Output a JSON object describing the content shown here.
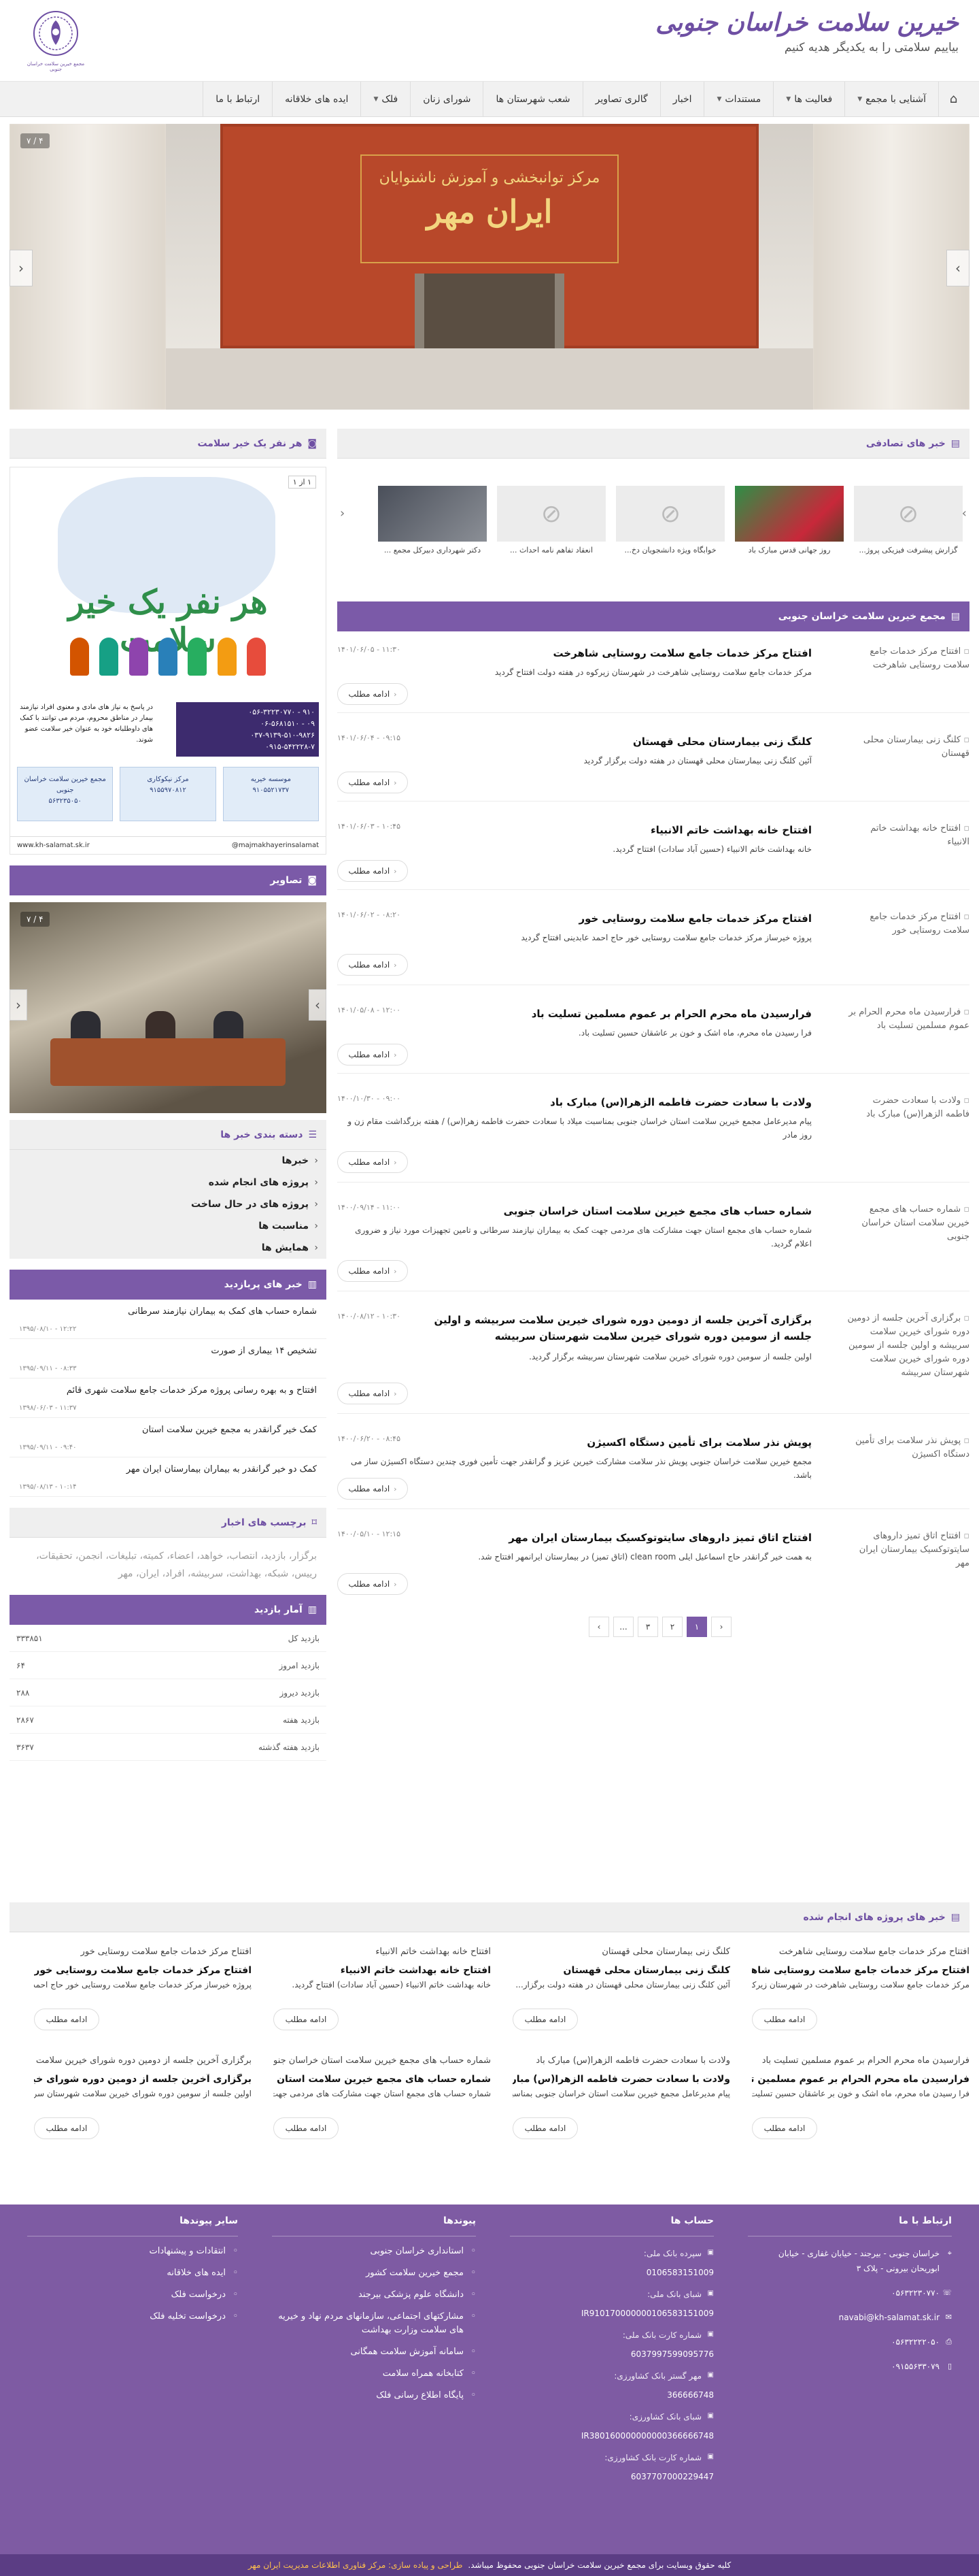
{
  "header": {
    "title": "خیرین سلامت خراسان جنوبی",
    "slogan": "بیاییم سلامتی را به یکدیگر هدیه کنیم",
    "emblem_text": "مجمع خیرین سلامت خراسان جنوبی"
  },
  "nav": {
    "home_icon": "home-icon",
    "items": [
      {
        "label": "آشنایی با مجمع",
        "dropdown": true
      },
      {
        "label": "فعالیت ها",
        "dropdown": true
      },
      {
        "label": "مستندات",
        "dropdown": true
      },
      {
        "label": "اخبار",
        "dropdown": false
      },
      {
        "label": "گالری تصاویر",
        "dropdown": false
      },
      {
        "label": "شعب شهرستان ها",
        "dropdown": false
      },
      {
        "label": "شورای زنان",
        "dropdown": false
      },
      {
        "label": "فلک",
        "dropdown": true
      },
      {
        "label": "ایده های خلاقانه",
        "dropdown": false
      },
      {
        "label": "ارتباط با ما",
        "dropdown": false
      }
    ]
  },
  "slider": {
    "counter": "۴ / ۷",
    "sign_line1": "مرکز توانبخشی و آموزش ناشنوایان",
    "sign_line2": "ایران مهر"
  },
  "random_news": {
    "heading": "خبر های تصادفی",
    "items": [
      {
        "caption": "گزارش پیشرفت فیزیکی پروژ...",
        "img": "placeholder"
      },
      {
        "caption": "روز جهانی قدس مبارک باد",
        "img": "flag"
      },
      {
        "caption": "خوابگاه ویژه دانشجویان دخ...",
        "img": "placeholder"
      },
      {
        "caption": "انعقاد تفاهم نامه احداث ...",
        "img": "placeholder"
      },
      {
        "caption": "دکتر شهرداری دبیرکل مجمع ...",
        "img": "photo"
      }
    ]
  },
  "main_news": {
    "heading": "مجمع خیرین سلامت خراسان جنوبی",
    "more_label": "ادامه مطلب",
    "items": [
      {
        "thumb": "افتتاح مرکز خدمات جامع سلامت روستایی شاهرخت",
        "title": "افتتاح مرکز خدمات جامع سلامت روستایی شاهرخت",
        "body": "مرکز خدمات جامع سلامت روستایی شاهرخت در شهرستان زیرکوه در هفته دولت افتتاح گردید",
        "date": "۱۴۰۱/۰۶/۰۵ - ۱۱:۳۰"
      },
      {
        "thumb": "کلنگ زنی بیمارستان محلی قهستان",
        "title": "کلنگ زنی بیمارستان محلی قهستان",
        "body": "آئین کلنگ زنی بیمارستان محلی قهستان در هفته دولت برگزار گردید",
        "date": "۱۴۰۱/۰۶/۰۴ - ۰۹:۱۵"
      },
      {
        "thumb": "افتتاح خانه بهداشت خاتم الانبیاء",
        "title": "افتتاح خانه بهداشت خاتم الانبیاء",
        "body": "خانه بهداشت خاتم الانبیاء (حسین آباد سادات) افتتاح گردید.",
        "date": "۱۴۰۱/۰۶/۰۳ - ۱۰:۴۵"
      },
      {
        "thumb": "افتتاح مرکز خدمات جامع سلامت روستایی خور",
        "title": "افتتاح مرکز خدمات جامع سلامت روستایی خور",
        "body": "پروژه خیرساز مرکز خدمات جامع سلامت روستایی خور حاج احمد عابدینی افتتاح گردید",
        "date": "۱۴۰۱/۰۶/۰۲ - ۰۸:۲۰"
      },
      {
        "thumb": "فرارسیدن ماه محرم الحرام بر عموم مسلمین تسلیت باد",
        "title": "فرارسیدن ماه محرم الحرام بر عموم مسلمین تسلیت باد",
        "body": "فرا رسیدن ماه محرم، ماه اشک و خون بر عاشقان حسین تسلیت باد.",
        "date": "۱۴۰۱/۰۵/۰۸ - ۱۲:۰۰"
      },
      {
        "thumb": "ولادت با سعادت حضرت فاطمه الزهرا(س) مبارک باد",
        "title": "ولادت با سعادت حضرت فاطمه الزهرا(س) مبارک باد",
        "body": "پیام مدیرعامل مجمع خیرین سلامت استان خراسان جنوبی بمناسبت میلاد با سعادت حضرت فاطمه زهرا(س) / هفته بزرگداشت مقام زن و روز مادر",
        "date": "۱۴۰۰/۱۰/۳۰ - ۰۹:۰۰"
      },
      {
        "thumb": "شماره حساب های مجمع خیرین سلامت استان خراسان جنوبی",
        "title": "شماره حساب های مجمع خیرین سلامت استان خراسان جنوبی",
        "body": "شماره حساب های مجمع استان جهت مشارکت های مردمی جهت کمک به بیماران نیازمند سرطانی و تامین تجهیزات مورد نیاز و ضروری اعلام گردید.",
        "date": "۱۴۰۰/۰۹/۱۴ - ۱۱:۰۰"
      },
      {
        "thumb": "برگزاری آخرین جلسه از دومین دوره شورای خیرین سلامت سربیشه و اولین جلسه از سومین دوره شورای خیرین سلامت شهرستان سربیشه",
        "title": "برگزاری آخرین جلسه از دومین دوره شورای خیرین سلامت سربیشه و اولین جلسه از سومین دوره شورای خیرین سلامت شهرستان سربیشه",
        "body": "اولین جلسه از سومین دوره شورای خیرین سلامت شهرستان سربیشه برگزار گردید.",
        "date": "۱۴۰۰/۰۸/۱۲ - ۱۰:۳۰"
      },
      {
        "thumb": "پویش نذر سلامت برای تأمین دستگاه اکسیژن",
        "title": "پویش نذر سلامت برای تأمین دستگاه اکسیژن",
        "body": "مجمع خیرین سلامت خراسان جنوبی پویش نذر سلامت مشارکت خیرین عزیز و گرانقدر جهت تأمین فوری چندین دستگاه اکسیژن ساز می باشد.",
        "date": "۱۴۰۰/۰۶/۲۰ - ۰۸:۴۵"
      },
      {
        "thumb": "افتتاح اتاق تمیز داروهای سایتوتوکسیک بیمارستان ایران مهر",
        "title": "افتتاح اتاق تمیز داروهای سایتوتوکسیک بیمارستان ایران مهر",
        "body": "به همت خیر گرانقدر حاج اسماعیل ایلی clean room (اتاق تمیز) در بیمارستان ایرانمهر افتتاح شد.",
        "date": "۱۴۰۰/۰۵/۱۰ - ۱۲:۱۵"
      }
    ]
  },
  "pagination": {
    "pages": [
      "۱",
      "۲",
      "۳",
      "...",
      "›"
    ],
    "prev": "‹",
    "active": "۱"
  },
  "sidebar": {
    "poster_heading": "هر نفر یک خیر سلامت",
    "poster": {
      "counter": "۱ از ۱",
      "title": "هر نفر یک خیر سلامت",
      "sub": "در پاسخ به نیاز های مادی و معنوی افراد نیازمند بیمار در مناطق محروم، مردم می توانند با کمک های داوطلبانه خود به عنوان خیر سلامت عضو شوند.",
      "phones": [
        "۰۵۶-۳۲۲۳۰۷۷۰ - ۹۱۰",
        "۰۶-۵۶۸۱۵۱۰ - ۰۹",
        "۰۳۷-۹۱۳۹-۵۱۰-۹۸۲۶",
        "۰۹۱۵-۵۴۲۲۲۸-۷"
      ],
      "card1": "مجمع خیرین سلامت خراسان جنوبی",
      "card2": "مرکز نیکوکاری",
      "card3": "موسسه خیریه",
      "card1_num": "۵۶۳۲۳۵۰۵۰",
      "card2_num": "۹۱۵۵۹۷۰۸۱۲",
      "card3_num": "۹۱۰۵۵۲۱۷۳۷",
      "site": "www.kh-salamat.sk.ir",
      "handle": "@majmakhayerinsalamat"
    },
    "gallery_heading": "تصاویر",
    "gallery_counter": "۴ / ۷",
    "categories_heading": "دسته بندی خبر ها",
    "categories": [
      "خبرها",
      "پروژه های انجام شده",
      "پروژه های در حال ساخت",
      "مناسبت ها",
      "همایش ها"
    ],
    "popular_heading": "خبر های پربازدید",
    "popular": [
      {
        "title": "شماره حساب های کمک به بیماران نیازمند سرطانی",
        "date": "۱۳۹۵/۰۸/۱۰ - ۱۲:۲۲"
      },
      {
        "title": "تشخیص ۱۴ بیماری از صورت",
        "date": "۱۳۹۵/۰۹/۱۱ - ۰۸:۳۳"
      },
      {
        "title": "افتتاح و به بهره رسانی پروژه مرکز خدمات جامع سلامت شهری قائم",
        "date": "۱۳۹۸/۰۶/۰۳ - ۱۱:۳۷"
      },
      {
        "title": "کمک خیر گرانقدر به مجمع خیرین سلامت استان",
        "date": "۱۳۹۵/۰۹/۱۱ - ۰۹:۴۰"
      },
      {
        "title": "کمک دو خیر گرانقدر به بیماران بیمارستان ایران مهر",
        "date": "۱۳۹۵/۰۸/۱۳ - ۱۰:۱۴"
      }
    ],
    "tags_heading": "برچسب های اخبار",
    "tags": "برگزار، بازدید، انتصاب، خواهد، اعضاء، کمیته، تبلیغات، انجمن، تحقیقات، رییس، شبکه، بهداشت، سربیشه، افراد، ایران، مهر",
    "stats_heading": "آمار بازدید",
    "stats": [
      {
        "label": "بازدید کل",
        "value": "۳۳۳۸۵۱"
      },
      {
        "label": "بازدید امروز",
        "value": "۶۴"
      },
      {
        "label": "بازدید دیروز",
        "value": "۲۸۸"
      },
      {
        "label": "بازدید هفته",
        "value": "۲۸۶۷"
      },
      {
        "label": "بازدید هفته گذشته",
        "value": "۳۶۳۷"
      }
    ]
  },
  "done_projects": {
    "heading": "خبر های پروژه های انجام شده",
    "items": [
      {
        "t1": "افتتاح مرکز خدمات جامع سلامت روستایی شاهرخت",
        "t2": "افتتاح مرکز خدمات جامع سلامت روستایی شاهرخت",
        "t3": "مرکز خدمات جامع سلامت روستایی شاهرخت در شهرستان زیرکوه..."
      },
      {
        "t1": "کلنگ زنی بیمارستان محلی قهستان",
        "t2": "کلنگ زنی بیمارستان محلی قهستان",
        "t3": "آئین کلنگ زنی بیمارستان محلی قهستان در هفته دولت برگزار..."
      },
      {
        "t1": "افتتاح خانه بهداشت خاتم الانبیاء",
        "t2": "افتتاح خانه بهداشت خاتم الانبیاء",
        "t3": "خانه بهداشت خاتم الانبیاء (حسین آباد سادات) افتتاح گردید."
      },
      {
        "t1": "افتتاح مرکز خدمات جامع سلامت روستایی خور",
        "t2": "افتتاح مرکز خدمات جامع سلامت روستایی خور",
        "t3": "پروژه خیرساز مرکز خدمات جامع سلامت روستایی خور حاج احمد..."
      },
      {
        "t1": "فرارسیدن ماه محرم الحرام بر عموم مسلمین تسلیت باد",
        "t2": "فرارسیدن ماه محرم الحرام بر عموم مسلمین تسلیت باد",
        "t3": "فرا رسیدن ماه محرم، ماه اشک و خون بر عاشقان حسین تسلیت باد."
      },
      {
        "t1": "ولادت با سعادت حضرت فاطمه الزهرا(س) مبارک باد",
        "t2": "ولادت با سعادت حضرت فاطمه الزهرا(س) مبارک باد",
        "t3": "پیام مدیرعامل مجمع خیرین سلامت استان خراسان جنوبی بمناسبت..."
      },
      {
        "t1": "شماره حساب های مجمع خیرین سلامت استان خراسان جنوبی",
        "t2": "شماره حساب های مجمع خیرین سلامت استان خراسا...",
        "t3": "شماره حساب های مجمع استان جهت مشارکت های مردمی جهت کمک..."
      },
      {
        "t1": "برگزاری آخرین جلسه از دومین دوره شورای خیرین سلامت سربیشه",
        "t2": "برگزاری آخرین جلسه از دومین دوره شورای خیرین سلا...",
        "t3": "اولین جلسه از سومین دوره شورای خیرین سلامت شهرستان سربیشه..."
      }
    ],
    "more_label": "ادامه مطلب"
  },
  "footer": {
    "contact_heading": "ارتباط با ما",
    "address": "خراسان جنوبی - بیرجند - خیابان غفاری - خیابان ابوریحان بیرونی - پلاک ۳",
    "phone": "۰۵۶۳۲۲۳۰۷۷۰",
    "email": "navabi@kh-salamat.sk.ir",
    "fax": "۰۵۶۳۲۲۲۲۰۵۰",
    "mobile": "۰۹۱۵۵۶۳۳۰۷۹",
    "accounts_heading": "حساب ها",
    "accounts": [
      {
        "label": "سپرده بانک ملی:",
        "num": "0106583151009"
      },
      {
        "label": "شبای بانک ملی:",
        "num": "IR910170000000106583151009"
      },
      {
        "label": "شماره کارت بانک ملی:",
        "num": "6037997599095776"
      },
      {
        "label": "مهر گستر بانک کشاورزی:",
        "num": "366666748"
      },
      {
        "label": "شبای بانک کشاورزی:",
        "num": "IR380160000000000366666748"
      },
      {
        "label": "شماره کارت بانک کشاورزی:",
        "num": "6037707000229447"
      }
    ],
    "links_heading": "پیوندها",
    "links": [
      "استانداری خراسان جنوبی",
      "مجمع خیرین سلامت کشور",
      "دانشگاه علوم پزشکی بیرجند",
      "مشارکتهای اجتماعی، سازمانهای مردم نهاد و خیریه های سلامت وزارت بهداشت",
      "سامانه آموزش سلامت همگانی",
      "کتابخانه همراه سلامت",
      "پایگاه اطلاع رسانی فلک"
    ],
    "other_heading": "سایر پیوندها",
    "other": [
      "انتقادات و پیشنهادات",
      "ایده های خلاقانه",
      "درخواست فلک",
      "درخواست تخلیه فلک"
    ],
    "copyright": "کلیه حقوق وبسایت برای مجمع خیرین سلامت خراسان جنوبی محفوظ میباشد.",
    "credit": "طراحی و پیاده سازی: مرکز فناوری اطلاعات مدیریت ایران مهر"
  }
}
